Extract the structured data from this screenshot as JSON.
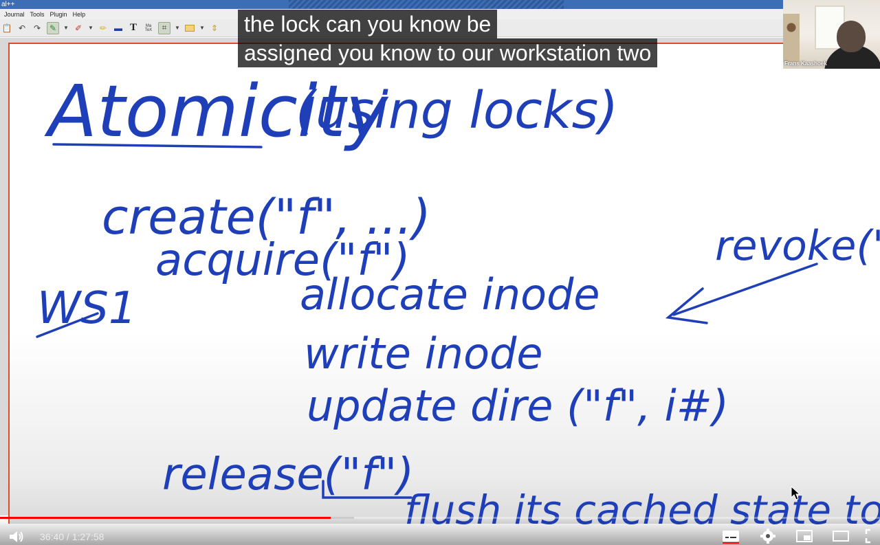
{
  "app": {
    "title": "al++",
    "menus": [
      "Journal",
      "Tools",
      "Plugin",
      "Help"
    ]
  },
  "caption": {
    "line1": "the lock can you know be",
    "line2": "assigned you know to our workstation two"
  },
  "webcam": {
    "name": "Frans Kaashoek"
  },
  "notes": {
    "title": "Atomicity",
    "subtitle": "(using locks)",
    "ws_label": "WS1",
    "create": "create(\"f\", ...)",
    "acquire": "acquire(\"f\")",
    "allocate": "allocate inode",
    "write": "write inode",
    "update": "update dire (\"f\", i#)",
    "release": "release(\"f\")",
    "revoke": "revoke(\"f\")",
    "flush": "flush its cached state to P"
  },
  "player": {
    "time": "36:40 / 1:27:58",
    "progress_fraction": 0.376,
    "buffer_fraction": 0.402
  },
  "colors": {
    "ink": "#1f3fb8",
    "progress": "#ff0000",
    "margin_line": "#e04a2a"
  }
}
